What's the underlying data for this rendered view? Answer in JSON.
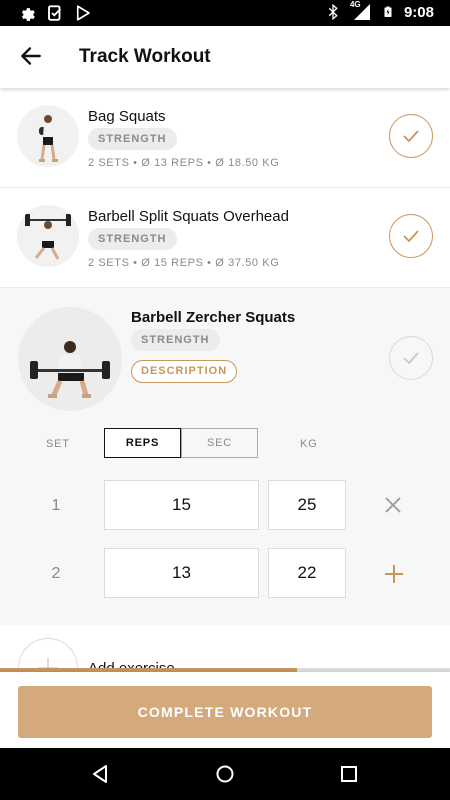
{
  "status_bar": {
    "time": "9:08",
    "left_icons": [
      "gear-icon",
      "clipboard-check-icon",
      "play-store-icon"
    ],
    "right_icons": [
      "bluetooth-icon",
      "signal-4g-icon",
      "battery-charging-icon"
    ],
    "network": "4G"
  },
  "header": {
    "title": "Track Workout",
    "back_icon": "arrow-left-icon"
  },
  "exercises": [
    {
      "name": "Bag Squats",
      "tag": "STRENGTH",
      "stats": "2 SETS • Ø 13 REPS  • Ø 18.50 KG",
      "completed": true
    },
    {
      "name": "Barbell Split Squats Overhead",
      "tag": "STRENGTH",
      "stats": "2 SETS • Ø 15 REPS  • Ø 37.50 KG",
      "completed": true
    }
  ],
  "active_exercise": {
    "name": "Barbell Zercher Squats",
    "tag": "STRENGTH",
    "description_label": "DESCRIPTION",
    "completed": false,
    "columns": {
      "set": "SET",
      "reps": "REPS",
      "sec": "SEC",
      "kg": "KG"
    },
    "mode_selected": "REPS",
    "sets": [
      {
        "number": "1",
        "reps": "15",
        "kg": "25",
        "action": "remove-icon"
      },
      {
        "number": "2",
        "reps": "13",
        "kg": "22",
        "action": "add-icon"
      }
    ]
  },
  "add_exercise": {
    "label": "Add exercise"
  },
  "progress": {
    "fraction": 0.66
  },
  "footer": {
    "complete_label": "COMPLETE WORKOUT"
  },
  "colors": {
    "accent": "#c8955a",
    "button": "#d4aa7d",
    "tag_bg": "#ececec",
    "muted_text": "#8a8a8a"
  }
}
